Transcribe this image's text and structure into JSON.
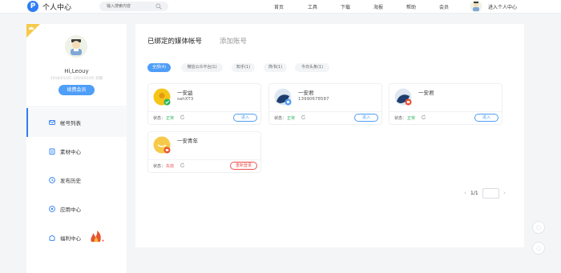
{
  "topbar": {
    "logo_letter": "P",
    "app_title": "个人中心",
    "search_placeholder": "输入搜索内容",
    "nav": [
      "首页",
      "工具",
      "下载",
      "海报",
      "帮助",
      "会员"
    ],
    "enter_center": "进入个人中心"
  },
  "sidebar": {
    "greeting": "Hi,Leouy",
    "expire_text": "2018/01/05 ·2019/01/05 到期",
    "vip_button": "续费会员",
    "menu": [
      {
        "label": "帐号列表",
        "icon": "account-list-icon",
        "active": true
      },
      {
        "label": "素材中心",
        "icon": "material-icon",
        "active": false
      },
      {
        "label": "发布历史",
        "icon": "history-icon",
        "active": false
      },
      {
        "label": "应用中心",
        "icon": "app-icon",
        "active": false
      },
      {
        "label": "福利中心",
        "icon": "gift-icon",
        "active": false
      }
    ]
  },
  "main": {
    "tab_bound": "已绑定的媒体帐号",
    "tab_add": "添加账号",
    "filters": [
      {
        "label": "全部(4)",
        "active": true
      },
      {
        "label": "微信公众平台(1)",
        "active": false
      },
      {
        "label": "知乎(1)",
        "active": false
      },
      {
        "label": "简书(1)",
        "active": false
      },
      {
        "label": "今日头条(1)",
        "active": false
      }
    ],
    "status_label": "状态：",
    "enter_label": "进入",
    "rebind_label": "重新登录",
    "cards": [
      {
        "name": "一安益",
        "id": "sahXT3",
        "status": "正常",
        "status_ok": true,
        "avatar": "yellow-badge-avatar"
      },
      {
        "name": "一安君",
        "id": "13990678587",
        "status": "正常",
        "status_ok": true,
        "avatar": "blue-circle-avatar"
      },
      {
        "name": "一安君",
        "id": "",
        "status": "正常",
        "status_ok": true,
        "avatar": "blue-circle-avatar"
      },
      {
        "name": "一安青年",
        "id": "",
        "status": "失效",
        "status_ok": false,
        "avatar": "yellow-smile-avatar"
      }
    ],
    "pager": {
      "text": "1/1",
      "prev": "‹",
      "next": "›"
    }
  },
  "colors": {
    "accent": "#4f9ef8",
    "ok": "#2db55d",
    "error": "#f05050",
    "brand": "#2f7df6"
  }
}
